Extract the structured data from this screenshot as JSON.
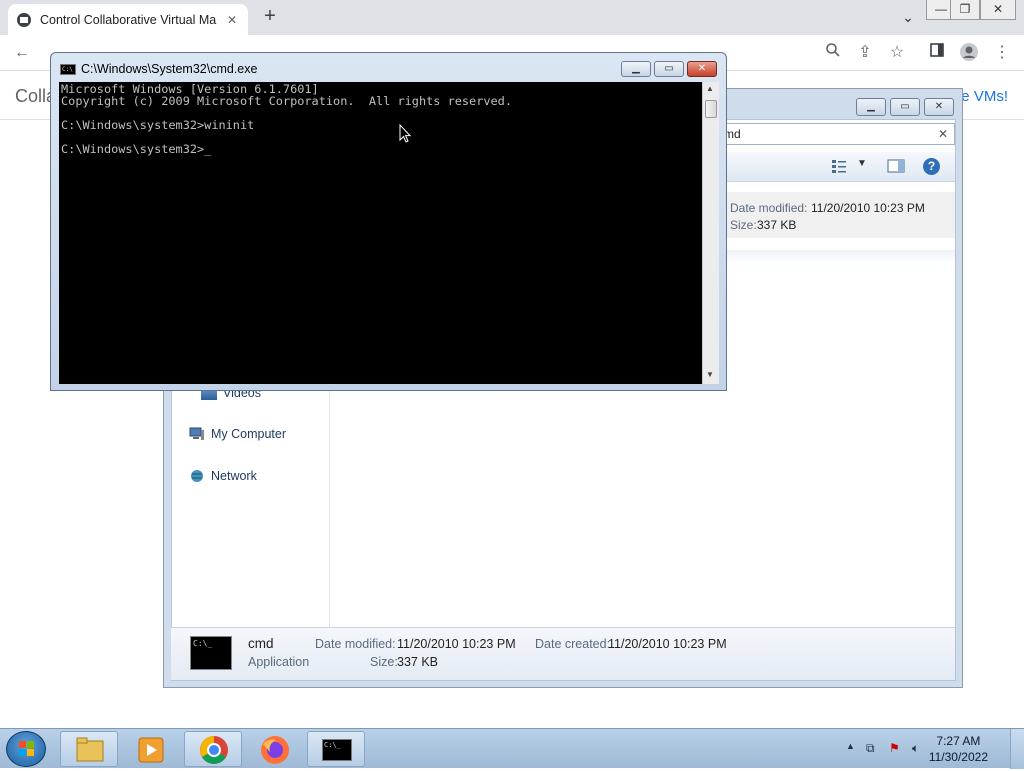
{
  "browser": {
    "tab_title": "Control Collaborative Virtual Ma",
    "tab_close": "✕",
    "new_tab": "+",
    "window_controls": {
      "minimize": "—",
      "restore": "❐",
      "close": "✕"
    }
  },
  "page": {
    "brand_partial": "Colla",
    "vms_link_partial": "re VMs!"
  },
  "explorer": {
    "search_value": "md",
    "search_clear": "✕",
    "result": {
      "date_modified_label": "Date modified:",
      "date_modified_value": "11/20/2010 10:23 PM",
      "size_label": "Size:",
      "size_value": "337 KB"
    },
    "nav": [
      {
        "label": "Videos"
      },
      {
        "label": "My Computer"
      },
      {
        "label": "Network"
      }
    ],
    "details": {
      "name": "cmd",
      "type": "Application",
      "date_modified_label": "Date modified:",
      "date_modified_value": "11/20/2010 10:23 PM",
      "date_created_label": "Date created:",
      "date_created_value": "11/20/2010 10:23 PM",
      "size_label": "Size:",
      "size_value": "337 KB"
    }
  },
  "cmd": {
    "title": "C:\\Windows\\System32\\cmd.exe",
    "lines": "Microsoft Windows [Version 6.1.7601]\nCopyright (c) 2009 Microsoft Corporation.  All rights reserved.\n\nC:\\Windows\\system32>wininit\n\nC:\\Windows\\system32>_"
  },
  "taskbar": {
    "clock_time": "7:27 AM",
    "clock_date": "11/30/2022"
  }
}
